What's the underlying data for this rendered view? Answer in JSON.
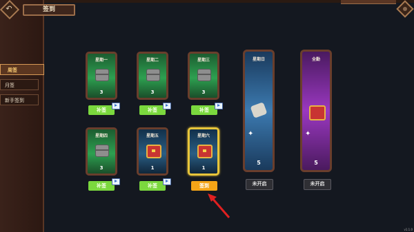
{
  "header": {
    "title": "签到",
    "back_icon": "back-arrow-icon"
  },
  "tabs": [
    {
      "label": "周签",
      "active": true
    },
    {
      "label": "月签",
      "active": false
    },
    {
      "label": "新手签到",
      "active": false
    }
  ],
  "days": [
    {
      "label": "星期一",
      "count": "3",
      "chest": "grey",
      "button": "补签",
      "button_style": "green",
      "video": true
    },
    {
      "label": "星期二",
      "count": "3",
      "chest": "grey",
      "button": "补签",
      "button_style": "green",
      "video": true
    },
    {
      "label": "星期三",
      "count": "3",
      "chest": "grey",
      "button": "补签",
      "button_style": "green",
      "video": true
    },
    {
      "label": "星期四",
      "count": "3",
      "chest": "grey",
      "button": "补签",
      "button_style": "green",
      "video": true
    },
    {
      "label": "星期五",
      "count": "1",
      "chest": "red",
      "button": "补签",
      "button_style": "green",
      "video": true
    },
    {
      "label": "星期六",
      "count": "1",
      "chest": "red",
      "button": "签到",
      "button_style": "orange",
      "video": false
    }
  ],
  "special": [
    {
      "label": "星期日",
      "count": "5",
      "item": "scroll",
      "button": "未开启"
    },
    {
      "label": "全勤",
      "count": "5",
      "item": "red-chest",
      "button": "未开启"
    }
  ],
  "colors": {
    "accent": "#f5a417",
    "green_button": "#7bd83e",
    "arrow": "#e02020"
  },
  "version": "v1.1.0"
}
